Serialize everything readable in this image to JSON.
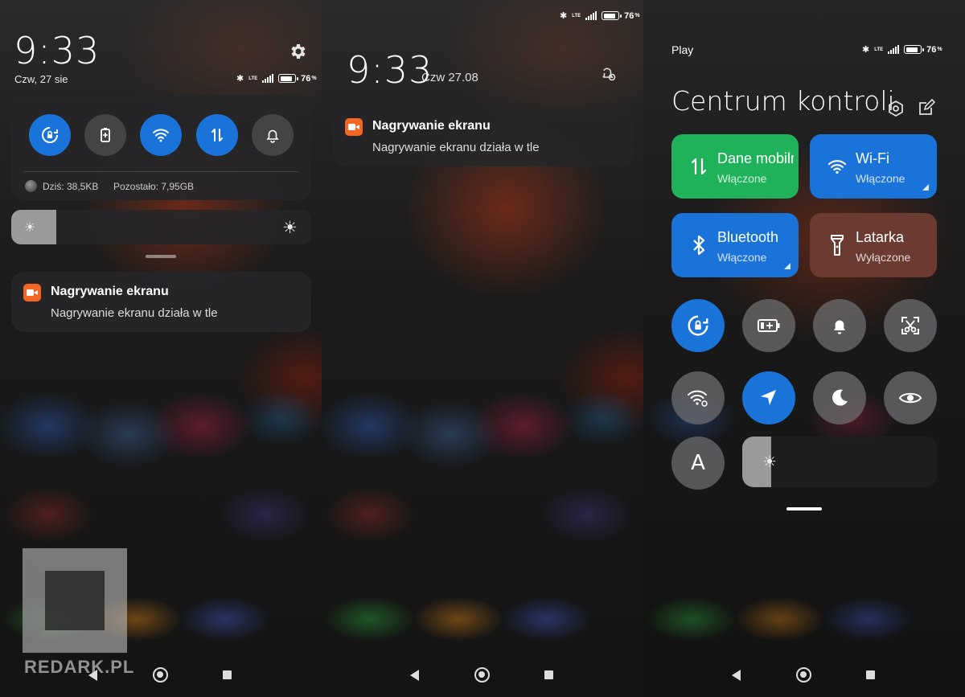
{
  "panel1": {
    "time": "9:33",
    "date": "Czw, 27 sie",
    "battery": "76",
    "battery_unit": "%",
    "network": "LTE",
    "data_today": "Dziś: 38,5KB",
    "data_remaining": "Pozostało: 7,95GB",
    "brightness_level": 0.15,
    "notification": {
      "title": "Nagrywanie ekranu",
      "body": "Nagrywanie ekranu działa w tle"
    },
    "quick_toggles": [
      {
        "icon": "rotation-lock-icon",
        "active": true
      },
      {
        "icon": "battery-saver-icon",
        "active": false
      },
      {
        "icon": "wifi-icon",
        "active": true
      },
      {
        "icon": "mobile-data-icon",
        "active": true
      },
      {
        "icon": "bell-icon",
        "active": false
      }
    ]
  },
  "panel2": {
    "time": "9:33",
    "date": "Czw 27.08",
    "battery": "76",
    "battery_unit": "%",
    "network": "LTE",
    "notification": {
      "title": "Nagrywanie ekranu",
      "body": "Nagrywanie ekranu działa w tle"
    }
  },
  "panel3": {
    "carrier": "Play",
    "battery": "76",
    "battery_unit": "%",
    "network": "LTE",
    "title": "Centrum kontroli",
    "tiles": [
      {
        "label": "Dane mobilne",
        "state": "Włączone",
        "color": "#1fb25a",
        "icon": "mobile-data-icon"
      },
      {
        "label": "Wi-Fi",
        "state": "Włączone",
        "color": "#1a73d9",
        "icon": "wifi-icon"
      },
      {
        "label": "Bluetooth",
        "state": "Włączone",
        "color": "#1a73d9",
        "icon": "bluetooth-icon"
      },
      {
        "label": "Latarka",
        "state": "Wyłączone",
        "color": "#6b3a30",
        "icon": "flashlight-icon"
      }
    ],
    "font_button": "A",
    "brightness_level": 0.15
  },
  "watermark": "REDARK.PL",
  "colors": {
    "accent_blue": "#1a73d9",
    "accent_green": "#1fb25a",
    "recording_orange": "#f26522"
  }
}
